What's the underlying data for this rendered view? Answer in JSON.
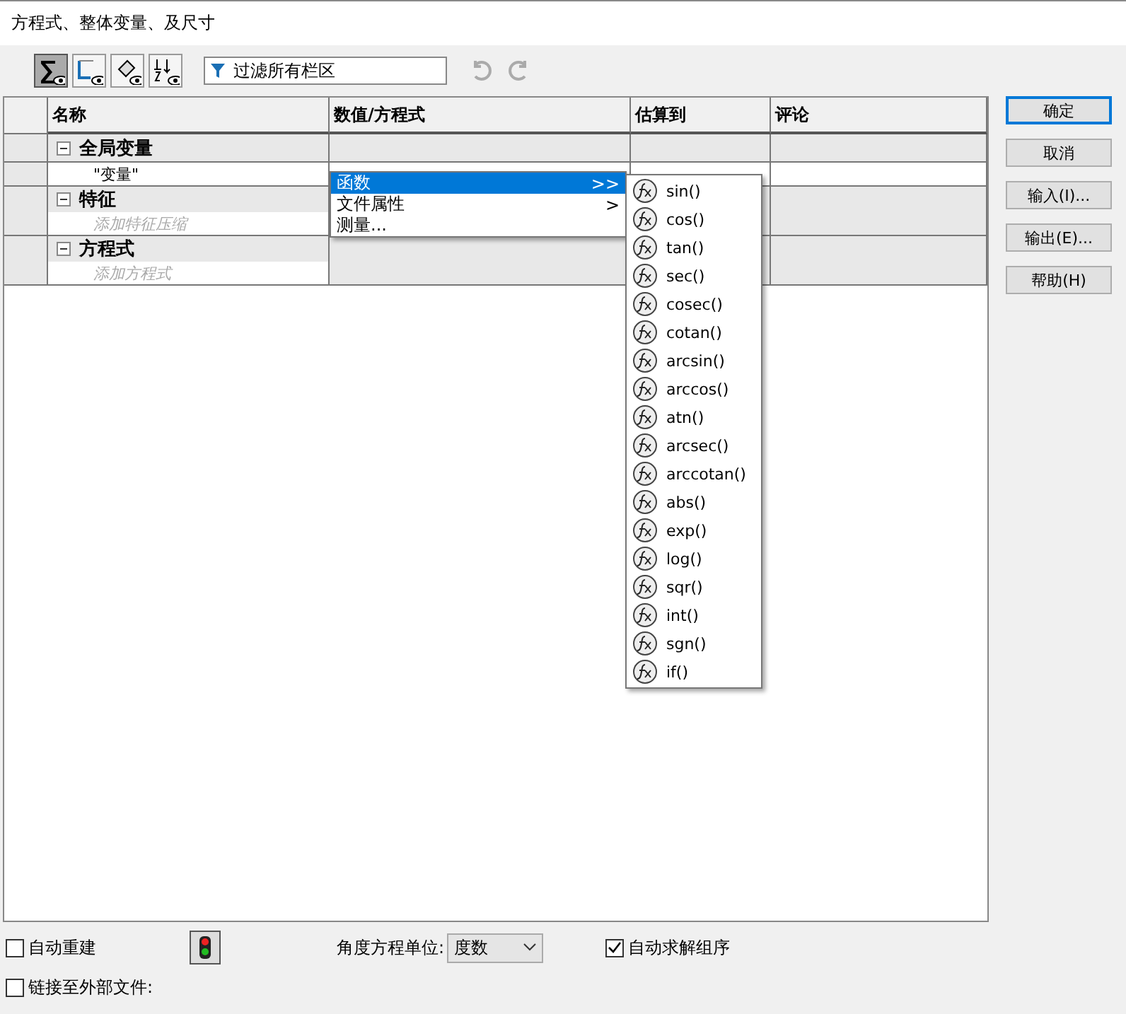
{
  "window": {
    "title": "方程式、整体变量、及尺寸"
  },
  "toolbar": {
    "views": [
      {
        "kind": "sum",
        "selected": true
      },
      {
        "kind": "sketch",
        "selected": false
      },
      {
        "kind": "feature",
        "selected": false
      },
      {
        "kind": "order",
        "selected": false
      }
    ],
    "filter": {
      "placeholder": "过滤所有栏区"
    }
  },
  "table": {
    "columns": [
      "名称",
      "数值/方程式",
      "估算到",
      "评论"
    ],
    "sections": [
      {
        "title": "全局变量",
        "expanded": true,
        "rows": [
          {
            "name": "\"变量\"",
            "hint": false
          }
        ]
      },
      {
        "title": "特征",
        "expanded": true,
        "rows": [
          {
            "name": "添加特征压缩",
            "hint": true
          }
        ]
      },
      {
        "title": "方程式",
        "expanded": true,
        "rows": [
          {
            "name": "添加方程式",
            "hint": true
          }
        ]
      }
    ]
  },
  "context_menu": {
    "items": [
      {
        "label": "函数",
        "arrow": ">>",
        "selected": true
      },
      {
        "label": "文件属性",
        "arrow": ">",
        "selected": false
      },
      {
        "label": "测量...",
        "selected": false
      }
    ]
  },
  "functions_menu": [
    "sin()",
    "cos()",
    "tan()",
    "sec()",
    "cosec()",
    "cotan()",
    "arcsin()",
    "arccos()",
    "atn()",
    "arcsec()",
    "arccotan()",
    "abs()",
    "exp()",
    "log()",
    "sqr()",
    "int()",
    "sgn()",
    "if()"
  ],
  "buttons": [
    {
      "label": "确定",
      "default": true
    },
    {
      "label": "取消",
      "default": false
    },
    {
      "label": "输入(I)...",
      "default": false
    },
    {
      "label": "输出(E)...",
      "default": false
    },
    {
      "label": "帮助(H)",
      "default": false
    }
  ],
  "options": {
    "auto_rebuild": {
      "label": "自动重建",
      "checked": false
    },
    "link_external": {
      "label": "链接至外部文件:",
      "checked": false
    },
    "angle_unit": {
      "label": "角度方程单位:",
      "value": "度数"
    },
    "auto_solve": {
      "label": "自动求解组序",
      "checked": true
    }
  }
}
